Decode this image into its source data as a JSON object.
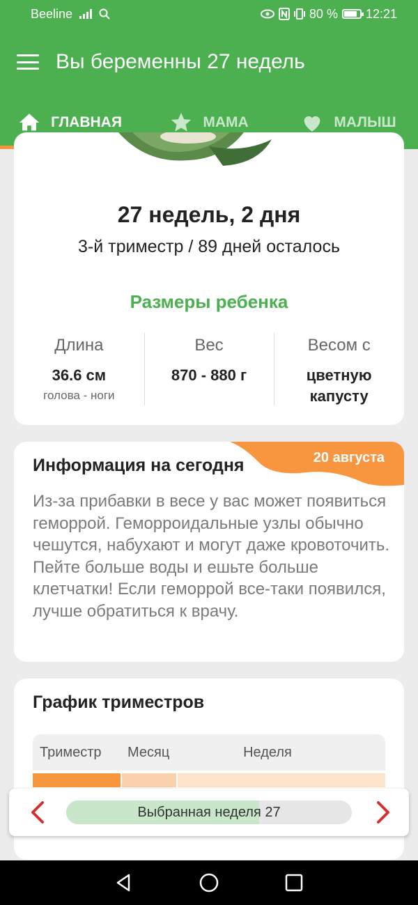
{
  "status_bar": {
    "carrier": "Beeline",
    "battery_text": "80 %",
    "battery_level": 0.8,
    "time": "12:21"
  },
  "app_bar": {
    "title": "Вы беременны 27 недель"
  },
  "tabs": [
    {
      "label": "ГЛАВНАЯ",
      "icon": "home-icon",
      "active": true
    },
    {
      "label": "МАМА",
      "icon": "star-icon",
      "active": false
    },
    {
      "label": "МАЛЫШ",
      "icon": "heart-icon",
      "active": false
    }
  ],
  "summary": {
    "weeks": "27 недель, 2 дня",
    "trimester": "3-й триместр / 89 дней осталось",
    "sizes_title": "Размеры ребенка",
    "length": {
      "label": "Длина",
      "value": "36.6 см",
      "sub": "голова - ноги"
    },
    "weight": {
      "label": "Вес",
      "value": "870 - 880 г"
    },
    "like": {
      "label": "Весом с",
      "value_line1": "цветную",
      "value_line2": "капусту"
    }
  },
  "info": {
    "date": "20 августа",
    "title": "Информация на сегодня",
    "text": "Из-за прибавки в весе у вас может появиться геморрой. Геморроидальные узлы обычно чешутся, набухают и могут даже кровоточить. Пейте больше воды и ешьте больше клетчатки! Если геморрой все-таки появился, лучше обратиться к врачу."
  },
  "schedule": {
    "title": "График триместров",
    "columns": [
      "Триместр",
      "Месяц",
      "Неделя"
    ]
  },
  "week_selector": {
    "label": "Выбранная неделя 27",
    "progress": 0.675
  },
  "colors": {
    "primary": "#4caf50",
    "accent": "#f7963e",
    "text_muted": "#7a7a7a"
  }
}
